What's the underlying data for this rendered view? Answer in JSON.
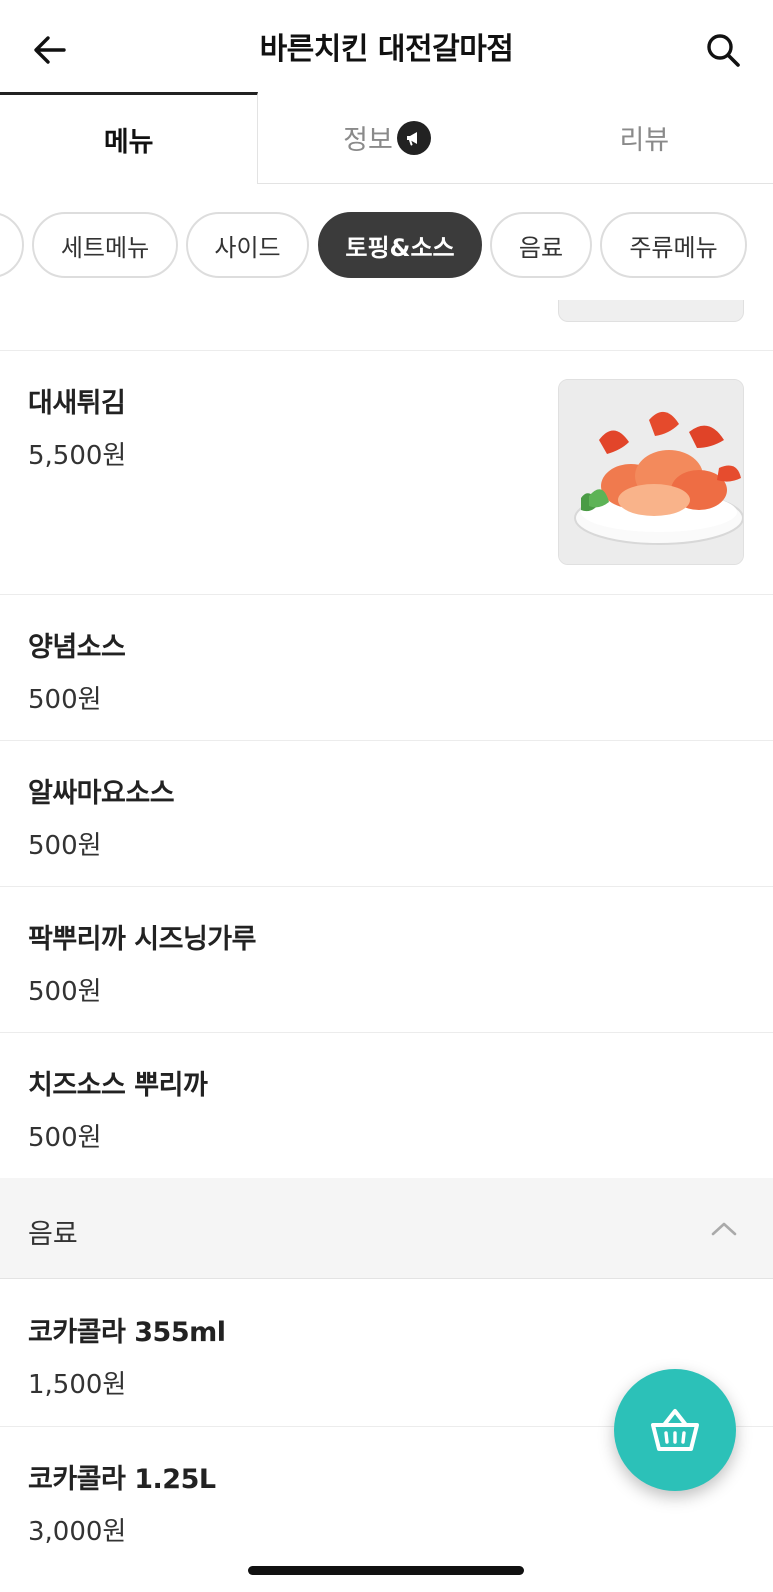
{
  "header": {
    "title": "바른치킨 대전갈마점"
  },
  "tabs": [
    {
      "label": "메뉴"
    },
    {
      "label": "정보"
    },
    {
      "label": "리뷰"
    }
  ],
  "chips": [
    {
      "label": "세트메뉴"
    },
    {
      "label": "사이드"
    },
    {
      "label": "토핑&소스"
    },
    {
      "label": "음료"
    },
    {
      "label": "주류메뉴"
    }
  ],
  "items": [
    {
      "name": "대새튀김",
      "price": "5,500원"
    },
    {
      "name": "양념소스",
      "price": "500원"
    },
    {
      "name": "알싸마요소스",
      "price": "500원"
    },
    {
      "name": "팍뿌리까 시즈닝가루",
      "price": "500원"
    },
    {
      "name": "치즈소스 뿌리까",
      "price": "500원"
    }
  ],
  "drinks_section": {
    "label": "음료",
    "items": [
      {
        "name": "코카콜라 355ml",
        "price": "1,500원"
      },
      {
        "name": "코카콜라 1.25L",
        "price": "3,000원"
      }
    ]
  },
  "colors": {
    "accent": "#2cc1b8",
    "chip_active": "#3b3b3b"
  }
}
